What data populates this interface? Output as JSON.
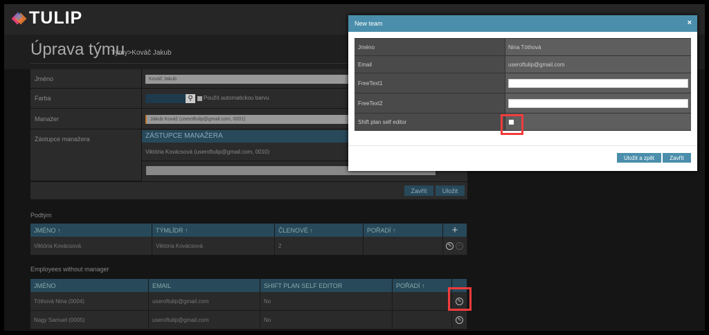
{
  "app": {
    "logo": "TULIP"
  },
  "page": {
    "title": "Úprava týmu",
    "breadcrumb": "Týmy>Kováč Jakub"
  },
  "form": {
    "name_label": "Jméno",
    "name_value": "Kováč Jakub",
    "color_label": "Farba",
    "auto_color_label": "Použít automatickou barvu",
    "manager_label": "Manažer",
    "manager_value": "Jakub Kováč (useroftulip@gmail.com, 0001)",
    "deputy_label": "Zástupce manažera",
    "deputy_header": "ZÁSTUPCE MANAŽERA",
    "deputy_value": "Viktória Kovácsová (useroftulip@gmail.com, 0010)",
    "close_button": "Zavřít",
    "save_button": "Uložit"
  },
  "subteam": {
    "title": "Podtým",
    "columns": [
      "JMÉNO ↑",
      "TÝMLÍDR ↑",
      "ČLENOVÉ ↑",
      "POŘADÍ ↑"
    ],
    "add_icon": "+",
    "rows": [
      {
        "name": "Viktória Kovácsová",
        "leader": "Viktória Kovácsová",
        "members": "2",
        "order": ""
      }
    ]
  },
  "employees": {
    "title": "Employees without manager",
    "columns": [
      "JMÉNO",
      "EMAIL",
      "SHIFT PLAN SELF EDITOR",
      "POŘADÍ ↑"
    ],
    "rows": [
      {
        "name": "Tóthová Nina (0004)",
        "email": "useroftulip@gmail.com",
        "editor": "No",
        "order": ""
      },
      {
        "name": "Nagy Samuel (0005)",
        "email": "useroftulip@gmail.com",
        "editor": "No",
        "order": ""
      }
    ]
  },
  "modal": {
    "title": "New team",
    "close": "×",
    "rows": [
      {
        "label": "Jméno",
        "value": "Nina Tóthová"
      },
      {
        "label": "Email",
        "value": "useroftulip@gmail.com"
      },
      {
        "label": "FreeText1",
        "value": ""
      },
      {
        "label": "FreeText2",
        "value": ""
      },
      {
        "label": "Shift plan self editor",
        "checked": false
      }
    ],
    "save_back_button": "Uložit a zpět",
    "close_button": "Zavřít"
  },
  "colors": {
    "accent": "#4a8eab",
    "header": "#27495a",
    "highlight": "#f23c3c"
  }
}
